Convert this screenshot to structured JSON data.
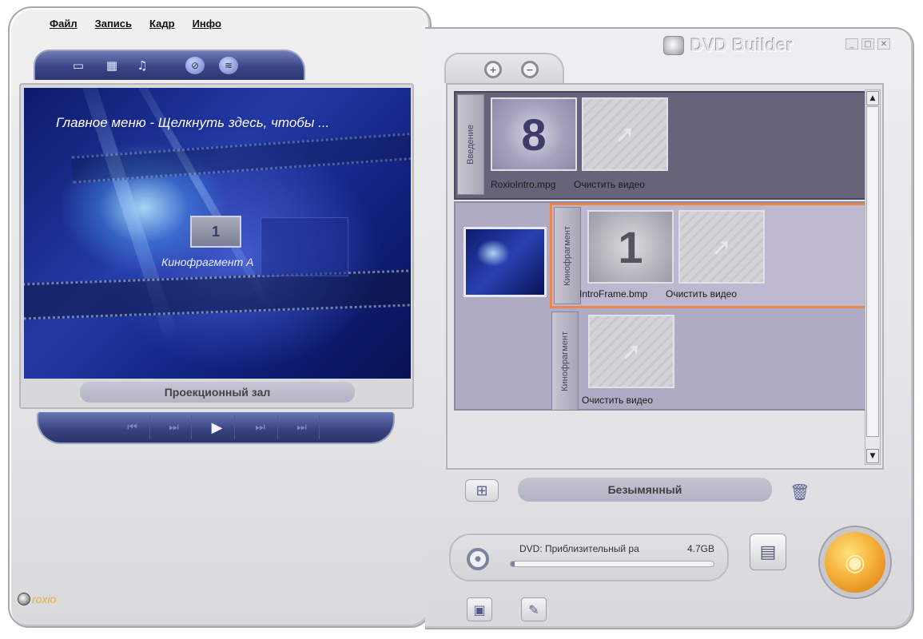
{
  "app": {
    "title": "DVD Builder",
    "window_controls": {
      "minimize": "_",
      "maximize": "□",
      "close": "✕"
    }
  },
  "menu": {
    "file": "Файл",
    "record": "Запись",
    "frame": "Кадр",
    "info": "Инфо"
  },
  "left_toolbar": {
    "icons": [
      "menu-icon",
      "film-icon",
      "music-icon",
      "globe-icon",
      "disc-stack-icon"
    ]
  },
  "preview": {
    "title": "Главное меню - Щелкнуть здесь, чтобы ...",
    "chapter_number": "1",
    "chapter_caption": "Кинофрагмент A",
    "label": "Проекционный зал"
  },
  "transport": {
    "first": "⏮",
    "prev": "⏭",
    "play": "▶",
    "next": "⏭",
    "last": "⏭"
  },
  "logo": {
    "text": "roxio"
  },
  "timeline": {
    "intro": {
      "tab_label": "Введение",
      "clip_number": "8",
      "clip_file": "RoxioIntro.mpg",
      "clear_label": "Очистить видео"
    },
    "chapters": [
      {
        "tab_label": "Кинофрагмент",
        "clip_number": "1",
        "clip_file": "IntroFrame.bmp",
        "clear_label": "Очистить видео"
      },
      {
        "tab_label": "Кинофрагмент",
        "clear_label": "Очистить видео"
      }
    ]
  },
  "project": {
    "name": "Безымянный"
  },
  "status": {
    "text": "DVD: Приблизительный ра",
    "size": "4.7GB",
    "progress": 0.02
  },
  "colors": {
    "selection": "#e5894c",
    "burn_button": "#f6b23c",
    "preview_blue": "#233aa6"
  }
}
